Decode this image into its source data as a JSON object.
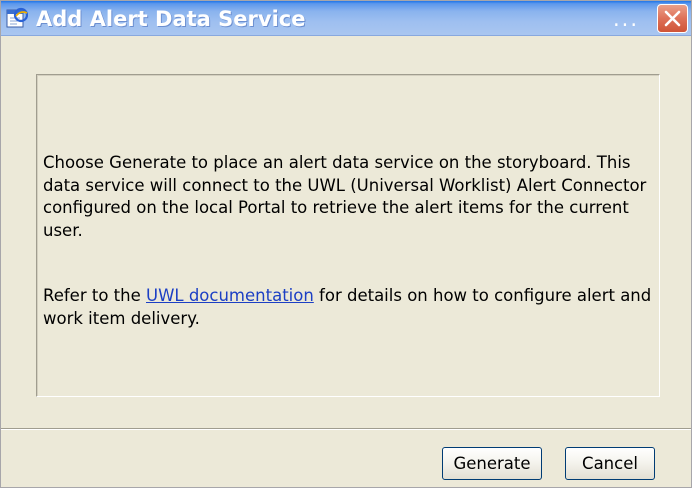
{
  "window": {
    "title": "Add Alert Data Service",
    "title_overflow": "...",
    "icon": "browser-page-icon",
    "close_icon": "close-icon"
  },
  "message": {
    "paragraph1": "Choose Generate to place an alert data service on the storyboard. This data service will connect to the UWL (Universal Worklist) Alert Connector configured on the local Portal to retrieve the alert items for the current user.",
    "paragraph2_before": "Refer to the ",
    "paragraph2_link": "UWL documentation",
    "paragraph2_after": " for details on how to configure alert and work item delivery."
  },
  "buttons": {
    "generate": "Generate",
    "cancel": "Cancel"
  },
  "colors": {
    "titlebar": "#9ebff0",
    "dialog_background": "#ece9d8",
    "close_button": "#de7158",
    "link": "#1c3fc4"
  }
}
